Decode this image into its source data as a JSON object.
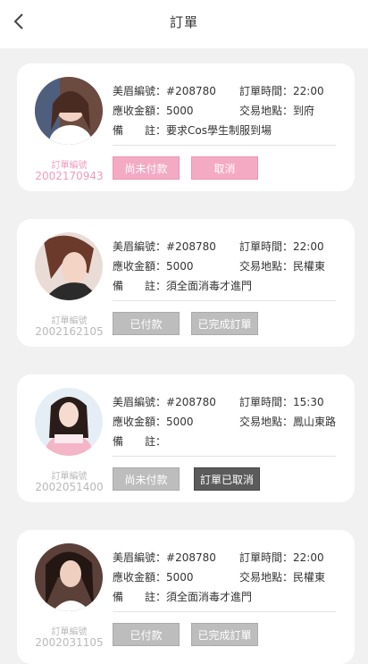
{
  "header": {
    "title": "訂單"
  },
  "labels": {
    "order_no": "訂單編號",
    "eyebrow_no": "美眉編號：",
    "amount": "應收金額：",
    "note": "備　　註：",
    "order_time": "訂單時間：",
    "location": "交易地點："
  },
  "orders": [
    {
      "order_number": "2002170943",
      "eyebrow_id": "#208780",
      "amount": "5000",
      "time": "22:00",
      "location": "到府",
      "note": "要求Cos學生制服到場",
      "buttons": [
        "尚未付款",
        "取消"
      ]
    },
    {
      "order_number": "2002162105",
      "eyebrow_id": "#208780",
      "amount": "5000",
      "time": "22:00",
      "location": "民權東",
      "note": "須全面消毒才進門",
      "buttons": [
        "已付款",
        "已完成訂單"
      ]
    },
    {
      "order_number": "2002051400",
      "eyebrow_id": "#208780",
      "amount": "5000",
      "time": "15:30",
      "location": "鳳山東路",
      "note": "",
      "buttons": [
        "尚未付款",
        "訂單已取消"
      ]
    },
    {
      "order_number": "2002031105",
      "eyebrow_id": "#208780",
      "amount": "5000",
      "time": "22:00",
      "location": "民權東",
      "note": "須全面消毒才進門",
      "buttons": [
        "已付款",
        "已完成訂單"
      ]
    }
  ],
  "colors": {
    "pink": "#f4aac3",
    "grey": "#bdbdbd",
    "dark": "#5b5b5b",
    "pink_text": "#f29bb8"
  }
}
